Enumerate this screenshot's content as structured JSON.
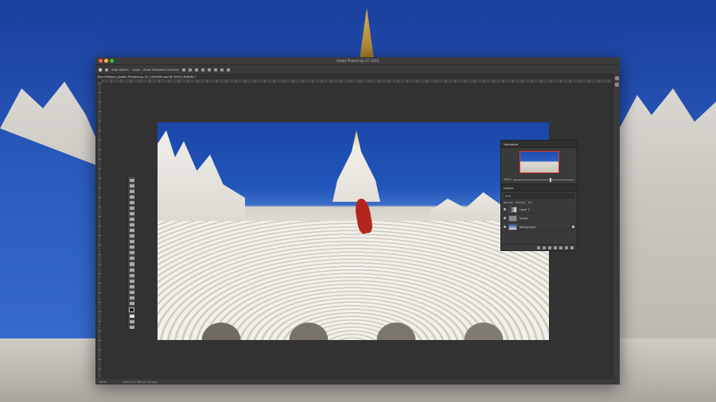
{
  "window": {
    "app_title": "Adobe Photoshop CC 2020",
    "doc_tab": "Ben Williams_Adobe_Photoshop_CC_1200x90.psd @ 100% (RGB/8) *"
  },
  "options_bar": {
    "auto_select": "Auto-Select:",
    "layer": "Layer",
    "show_transform": "Show Transform Controls"
  },
  "status_bar": {
    "zoom": "100%",
    "doc_info": "1200 px x 506 px (72 ppi)"
  },
  "navigator": {
    "tab": "Navigator",
    "zoom": "100%",
    "zoom_level": 0.6
  },
  "layers": {
    "tab": "Layers",
    "filter_kind": "Kind",
    "blend_mode": "Normal",
    "opacity_label": "Opacity:",
    "fill_label": "Fill:",
    "items": [
      {
        "name": "Layer 1"
      },
      {
        "name": "Image"
      },
      {
        "name": "Background"
      }
    ]
  }
}
